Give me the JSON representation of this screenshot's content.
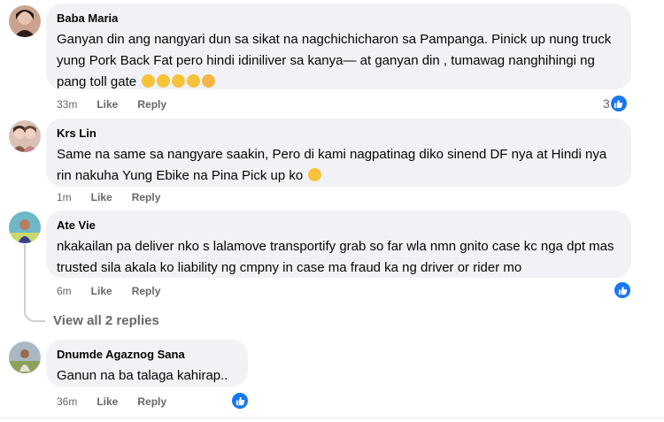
{
  "comments": [
    {
      "author": "Baba Maria",
      "text": "Ganyan din ang nangyari dun sa sikat na nagchichicharon sa Pampanga. Pinick up nung truck yung Pork Back Fat pero hindi idiniliver sa kanya— at ganyan din , tumawag nanghihingi ng pang toll gate",
      "time": "33m",
      "like": "Like",
      "reply": "Reply",
      "reaction_count": "3"
    },
    {
      "author": "Krs Lin",
      "text": "Same na same sa nangyare saakin, Pero di kami nagpatinag diko sinend DF nya at Hindi nya rin nakuha Yung Ebike na Pina Pick up ko",
      "time": "1m",
      "like": "Like",
      "reply": "Reply"
    },
    {
      "author": "Ate Vie",
      "text": "nkakailan pa deliver nko s lalamove transportify grab so far wla nmn gnito case kc nga dpt mas trusted sila akala ko liability ng cmpny in case ma fraud ka ng driver or rider mo",
      "time": "6m",
      "like": "Like",
      "reply": "Reply"
    },
    {
      "author": "Dnumde Agaznog Sana",
      "text": "Ganun na ba talaga kahirap..",
      "time": "36m",
      "like": "Like",
      "reply": "Reply"
    }
  ],
  "view_replies": "View all 2 replies",
  "icons": {
    "like_badge": "thumbs-up-icon",
    "emoji_cry": "crying-face-icon",
    "emoji_scream": "screaming-face-icon",
    "emoji_tired": "tired-face-icon",
    "emoji_laugh": "rolling-laughing-face-icon"
  },
  "colors": {
    "accent": "#1877f2",
    "bubble": "#f0f2f5",
    "muted": "#65676b"
  }
}
